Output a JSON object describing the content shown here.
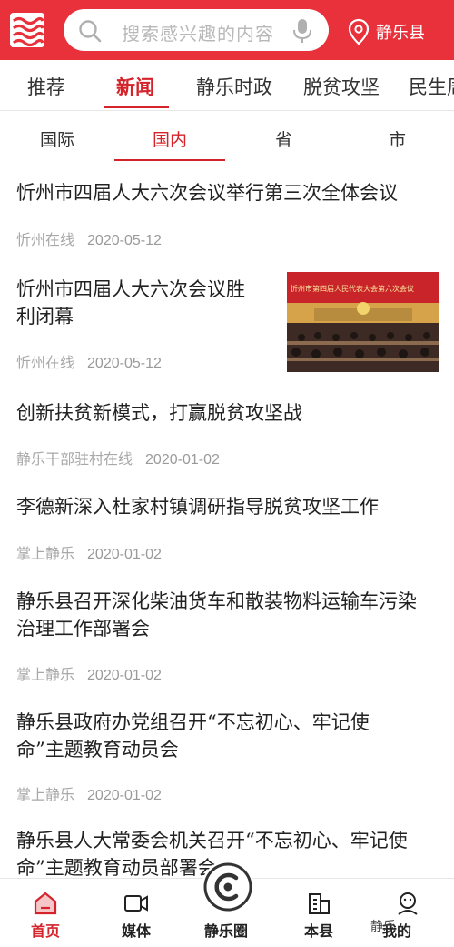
{
  "header": {
    "search_placeholder": "搜索感兴趣的内容",
    "location": "静乐县",
    "brand_color": "#e8313a"
  },
  "tabs": [
    {
      "label": "推荐",
      "active": false
    },
    {
      "label": "新闻",
      "active": true
    },
    {
      "label": "静乐时政",
      "active": false
    },
    {
      "label": "脱贫攻坚",
      "active": false
    },
    {
      "label": "民生周",
      "active": false
    }
  ],
  "subtabs": [
    {
      "label": "国际",
      "active": false
    },
    {
      "label": "国内",
      "active": true
    },
    {
      "label": "省",
      "active": false
    },
    {
      "label": "市",
      "active": false
    }
  ],
  "news": [
    {
      "title_lines": [
        "忻州市四届人大六次会议举行第三次全体会议"
      ],
      "source": "忻州在线",
      "date": "2020-05-12",
      "has_image": false
    },
    {
      "title_lines": [
        "忻州市四届人大六次会议胜",
        "利闭幕"
      ],
      "source": "忻州在线",
      "date": "2020-05-12",
      "has_image": true,
      "image_banner": "忻州市第四届人民代表大会第六次会议"
    },
    {
      "title_lines": [
        "创新扶贫新模式，打赢脱贫攻坚战"
      ],
      "source": "静乐干部驻村在线",
      "date": "2020-01-02",
      "has_image": false
    },
    {
      "title_lines": [
        "李德新深入杜家村镇调研指导脱贫攻坚工作"
      ],
      "source": "掌上静乐",
      "date": "2020-01-02",
      "has_image": false
    },
    {
      "title_lines": [
        "静乐县召开深化柴油货车和散装物料运输车污染",
        "治理工作部署会"
      ],
      "source": "掌上静乐",
      "date": "2020-01-02",
      "has_image": false
    },
    {
      "title_lines": [
        "静乐县政府办党组召开“不忘初心、牢记使",
        "命”主题教育动员会"
      ],
      "source": "掌上静乐",
      "date": "2020-01-02",
      "has_image": false
    },
    {
      "title_lines": [
        "静乐县人大常委会机关召开“不忘初心、牢记使",
        "命”主题教育动员部署会"
      ],
      "source": "",
      "date": "",
      "has_image": false
    }
  ],
  "bottom_nav": [
    {
      "label": "首页",
      "icon": "home-icon",
      "active": true
    },
    {
      "label": "媒体",
      "icon": "video-icon",
      "active": false
    },
    {
      "label": "静乐圈",
      "icon": "circle-logo-icon",
      "active": false
    },
    {
      "label": "本县",
      "icon": "building-icon",
      "active": false
    },
    {
      "label": "我的",
      "icon": "user-icon",
      "active": false
    }
  ],
  "watermark": "静乐"
}
